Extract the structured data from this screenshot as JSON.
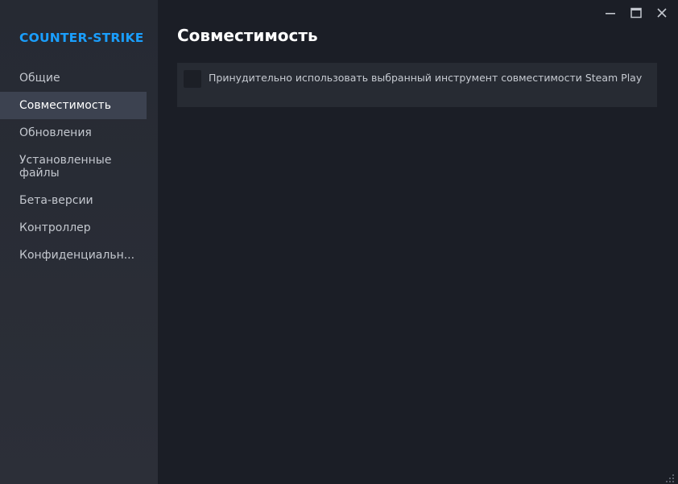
{
  "sidebar": {
    "game_title": "COUNTER-STRIKE",
    "items": [
      {
        "label": "Общие"
      },
      {
        "label": "Совместимость",
        "active": true
      },
      {
        "label": "Обновления"
      },
      {
        "label": "Установленные файлы"
      },
      {
        "label": "Бета-версии"
      },
      {
        "label": "Контроллер"
      },
      {
        "label": "Конфиденциальн..."
      }
    ]
  },
  "main": {
    "title": "Совместимость",
    "option": {
      "checked": false,
      "label": "Принудительно использовать выбранный инструмент совместимости Steam Play"
    }
  },
  "window_controls": {
    "icons": [
      "minimize-icon",
      "maximize-icon",
      "close-icon"
    ]
  },
  "colors": {
    "accent": "#1a9fff",
    "sidebar_bg": "#2a2d36",
    "main_bg": "#1b1e26",
    "active_item_bg": "#3c4250"
  }
}
